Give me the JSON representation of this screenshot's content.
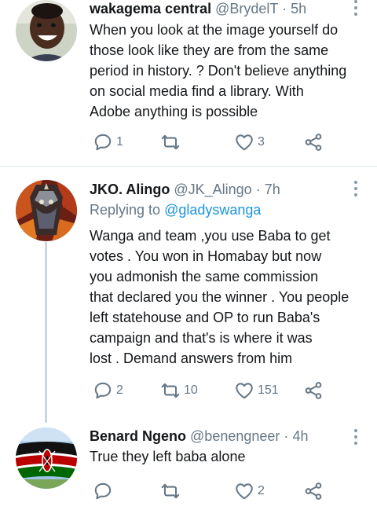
{
  "tweets": [
    {
      "name": "wakagema central",
      "handle": "@BrydelT",
      "time": "5h",
      "text_lines": [
        "When you look at the image yourself do",
        "those look like they are from the same",
        "period in history. ? Don't believe anything",
        "on social media find a library. With",
        "Adobe anything is possible"
      ],
      "replies": "1",
      "retweets": "",
      "likes": "3"
    },
    {
      "name": "JKO. Alingo",
      "handle": "@JK_Alingo",
      "time": "7h",
      "replying_prefix": "Replying to ",
      "replying_to": "@gladyswanga",
      "text_lines": [
        "Wanga and team ,you use Baba to get",
        "votes . You won in Homabay but now",
        "you admonish the same commission",
        "that declared you the winner . You people",
        "left statehouse and OP to run Baba's",
        "campaign and that's is where it was",
        "lost . Demand answers from him"
      ],
      "replies": "2",
      "retweets": "10",
      "likes": "151"
    },
    {
      "name": "Benard Ngeno",
      "handle": "@benengneer",
      "time": "4h",
      "text_lines": [
        "True they left baba alone"
      ],
      "replies": "",
      "retweets": "",
      "likes": "2"
    }
  ],
  "separator": "·",
  "icons": {
    "reply": "reply-icon",
    "retweet": "retweet-icon",
    "like": "heart-icon",
    "share": "share-icon",
    "more": "more-vertical-icon"
  },
  "colors": {
    "link": "#1b95e0",
    "secondary_text": "#657786",
    "divider": "#e1e8ed"
  }
}
